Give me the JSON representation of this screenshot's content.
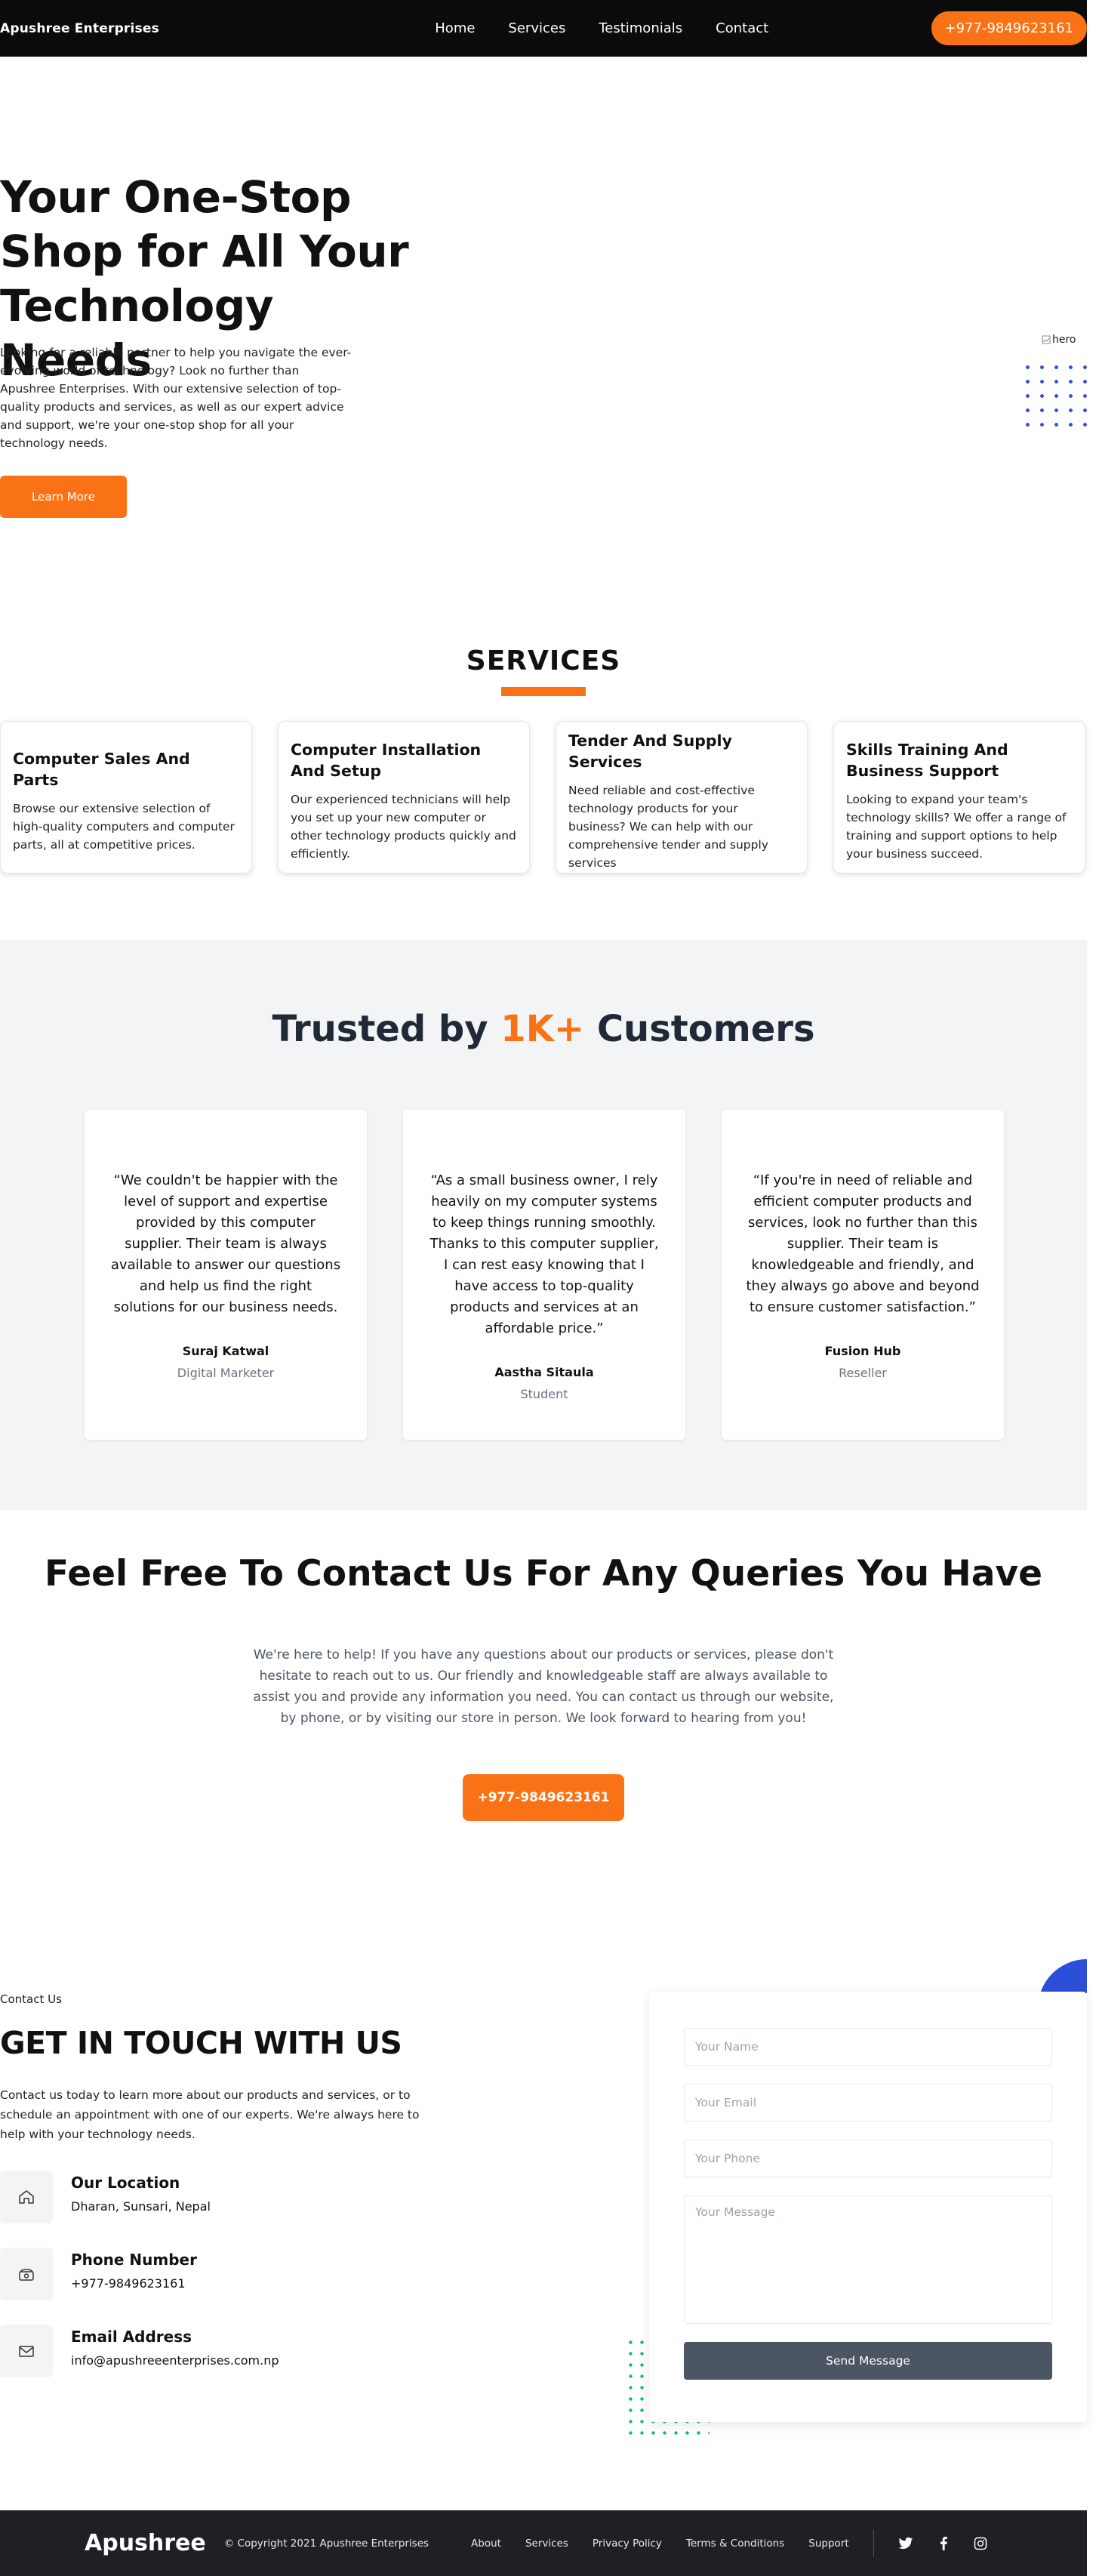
{
  "header": {
    "brand": "Apushree Enterprises",
    "nav": [
      "Home",
      "Services",
      "Testimonials",
      "Contact"
    ],
    "phone": "+977-9849623161"
  },
  "hero": {
    "title": "Your One-Stop Shop for All Your Technology Needs",
    "description": "Looking for a reliable partner to help you navigate the ever-evolving world of technology? Look no further than Apushree Enterprises. With our extensive selection of top-quality products and services, as well as our expert advice and support, we're your one-stop shop for all your technology needs.",
    "button": "Learn More",
    "image_alt": "hero"
  },
  "services": {
    "title": "SERVICES",
    "items": [
      {
        "title": "Computer Sales And Parts",
        "text": "Browse our extensive selection of high-quality computers and computer parts, all at competitive prices."
      },
      {
        "title": "Computer Installation And Setup",
        "text": "Our experienced technicians will help you set up your new computer or other technology products quickly and efficiently."
      },
      {
        "title": "Tender And Supply Services",
        "text": "Need reliable and cost-effective technology products for your business? We can help with our comprehensive tender and supply services"
      },
      {
        "title": "Skills Training And Business Support",
        "text": "Looking to expand your team's technology skills? We offer a range of training and support options to help your business succeed."
      }
    ]
  },
  "testimonials": {
    "title_pre": "Trusted by",
    "title_accent": "1K+",
    "title_post": "Customers",
    "items": [
      {
        "quote": "“We couldn't be happier with the level of support and expertise provided by this computer supplier. Their team is always available to answer our questions and help us find the right solutions for our business needs.",
        "name": "Suraj Katwal",
        "role": "Digital Marketer"
      },
      {
        "quote": "“As a small business owner, I rely heavily on my computer systems to keep things running smoothly. Thanks to this computer supplier, I can rest easy knowing that I have access to top-quality products and services at an affordable price.”",
        "name": "Aastha Sitaula",
        "role": "Student"
      },
      {
        "quote": "“If you're in need of reliable and efficient computer products and services, look no further than this supplier. Their team is knowledgeable and friendly, and they always go above and beyond to ensure customer satisfaction.”",
        "name": "Fusion Hub",
        "role": "Reseller"
      }
    ]
  },
  "cta": {
    "title": "Feel Free To Contact Us For Any Queries You Have",
    "description": "We're here to help! If you have any questions about our products or services, please don't hesitate to reach out to us. Our friendly and knowledgeable staff are always available to assist you and provide any information you need. You can contact us through our website, by phone, or by visiting our store in person. We look forward to hearing from you!",
    "button": "+977-9849623161"
  },
  "contact": {
    "kicker": "Contact Us",
    "title": "GET IN TOUCH WITH US",
    "description": "Contact us today to learn more about our products and services, or to schedule an appointment with one of our experts. We're always here to help with your technology needs.",
    "location_label": "Our Location",
    "location_value": "Dharan, Sunsari, Nepal",
    "phone_label": "Phone Number",
    "phone_value": "+977-9849623161",
    "email_label": "Email Address",
    "email_value": "info@apushreeenterprises.com.np",
    "form": {
      "name_placeholder": "Your Name",
      "email_placeholder": "Your Email",
      "phone_placeholder": "Your Phone",
      "message_placeholder": "Your Message",
      "send": "Send Message"
    }
  },
  "footer": {
    "logo": "Apushree",
    "copyright": "© Copyright 2021 Apushree Enterprises",
    "links": [
      "About",
      "Services",
      "Privacy Policy",
      "Terms & Conditions",
      "Support"
    ],
    "social_icons": [
      "twitter-icon",
      "facebook-icon",
      "instagram-icon"
    ]
  },
  "colors": {
    "accent": "#f97316",
    "dark": "#0b0b0b",
    "blue": "#2b4fd8",
    "green": "#10b981"
  }
}
